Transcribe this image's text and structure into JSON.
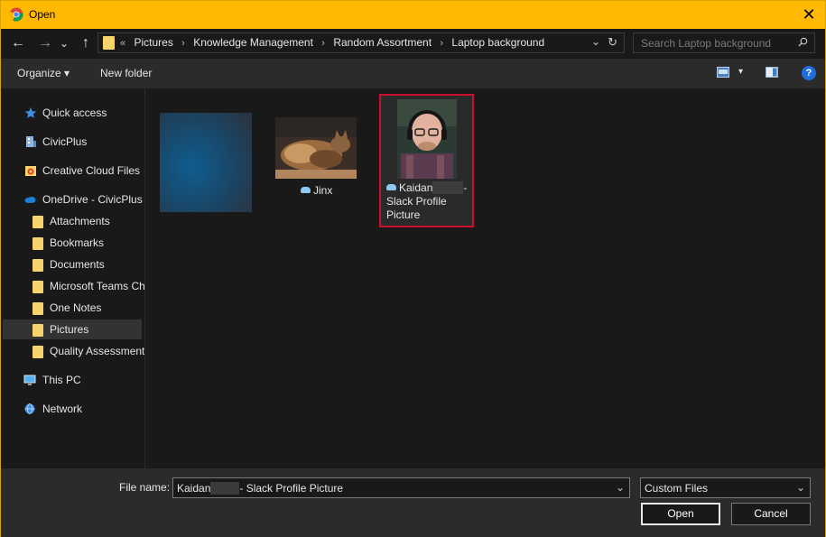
{
  "window": {
    "title": "Open",
    "close_glyph": "✕"
  },
  "nav": {
    "back_glyph": "←",
    "forward_glyph": "→",
    "recent_glyph": "⌄",
    "up_glyph": "↑",
    "overflow": "«",
    "breadcrumbs": [
      "Pictures",
      "Knowledge Management",
      "Random Assortment",
      "Laptop background"
    ],
    "separator": "›",
    "dropdown_glyph": "⌄",
    "refresh_glyph": "↻",
    "search_placeholder": "Search Laptop background"
  },
  "toolbar": {
    "organize": "Organize ▾",
    "new_folder": "New folder",
    "view_dd": "▾",
    "help": "?"
  },
  "sidebar": {
    "items": [
      {
        "label": "Quick access",
        "icon": "star-icon"
      },
      {
        "label": "CivicPlus",
        "icon": "building-icon"
      },
      {
        "label": "Creative Cloud Files",
        "icon": "creative-cloud-icon"
      },
      {
        "label": "OneDrive - CivicPlus",
        "icon": "cloud-icon"
      },
      {
        "label": "Attachments",
        "icon": "folder-icon"
      },
      {
        "label": "Bookmarks",
        "icon": "folder-icon"
      },
      {
        "label": "Documents",
        "icon": "folder-icon"
      },
      {
        "label": "Microsoft Teams Ch",
        "icon": "folder-icon"
      },
      {
        "label": "One Notes",
        "icon": "folder-icon"
      },
      {
        "label": "Pictures",
        "icon": "folder-icon",
        "selected": true
      },
      {
        "label": "Quality Assessment",
        "icon": "folder-icon"
      },
      {
        "label": "This PC",
        "icon": "computer-icon"
      },
      {
        "label": "Network",
        "icon": "network-icon"
      }
    ]
  },
  "files": [
    {
      "name": "",
      "blurred": true
    },
    {
      "name": "Jinx",
      "cloud": true
    },
    {
      "name_line1_start": "Kaidan",
      "name_line1_end": "-",
      "name_line2": "Slack Profile",
      "name_line3": "Picture",
      "cloud": true,
      "selected": true
    }
  ],
  "footer": {
    "file_name_label": "File name:",
    "file_name_start": "Kaidan",
    "file_name_end": "- Slack Profile Picture",
    "filter": "Custom Files",
    "dropdown_glyph": "⌄",
    "open": "Open",
    "cancel": "Cancel"
  },
  "colors": {
    "title_bar": "#ffb900",
    "selection_border": "#c8102e",
    "background": "#191919"
  }
}
